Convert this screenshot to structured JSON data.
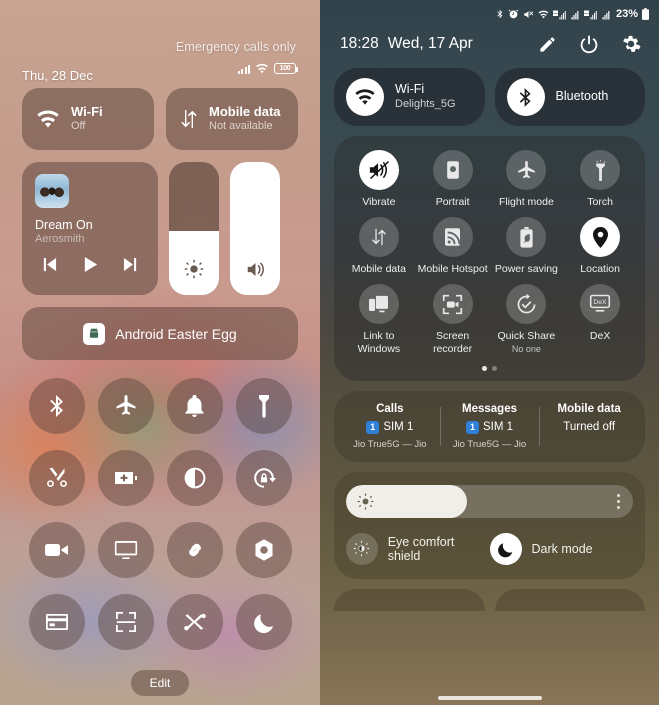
{
  "left": {
    "status": {
      "carrier_text": "Emergency calls only",
      "datetime": "Thu, 28 Dec",
      "battery_level": "100",
      "signal_icon": "signal-bars-icon",
      "wifi_icon": "wifi-icon",
      "battery_icon": "battery-icon"
    },
    "tiles": [
      {
        "name": "wifi",
        "title": "Wi-Fi",
        "sub": "Off",
        "icon": "wifi-icon"
      },
      {
        "name": "mobile-data",
        "title": "Mobile data",
        "sub": "Not available",
        "icon": "data-arrows-icon"
      }
    ],
    "media": {
      "track_title": "Dream On",
      "artist": "Aerosmith",
      "album_art_icon": "album-art",
      "prev_icon": "skip-previous-icon",
      "play_icon": "play-icon",
      "next_icon": "skip-next-icon"
    },
    "sliders": {
      "brightness": {
        "icon": "brightness-icon",
        "value": 48
      },
      "volume": {
        "icon": "volume-icon",
        "value": 100
      }
    },
    "easter_egg": {
      "label": "Android Easter Egg",
      "icon": "android-icon"
    },
    "toggles": [
      {
        "name": "bluetooth",
        "icon": "bluetooth-icon"
      },
      {
        "name": "airplane-mode",
        "icon": "airplane-icon"
      },
      {
        "name": "ring-mode",
        "icon": "bell-icon"
      },
      {
        "name": "flashlight",
        "icon": "flashlight-icon"
      },
      {
        "name": "screenshot",
        "icon": "scissors-icon"
      },
      {
        "name": "battery-saver",
        "icon": "battery-plus-icon"
      },
      {
        "name": "dark-theme",
        "icon": "contrast-circle-icon"
      },
      {
        "name": "auto-rotate",
        "icon": "rotation-lock-icon"
      },
      {
        "name": "screen-record",
        "icon": "video-camera-icon"
      },
      {
        "name": "cast",
        "icon": "screen-cast-icon"
      },
      {
        "name": "nearby-link",
        "icon": "chain-link-icon"
      },
      {
        "name": "camera-shortcut",
        "icon": "aperture-icon"
      },
      {
        "name": "wallet",
        "icon": "wallet-card-icon"
      },
      {
        "name": "qr-scanner",
        "icon": "qr-scan-icon"
      },
      {
        "name": "nearby-share",
        "icon": "nearby-share-icon"
      },
      {
        "name": "do-not-disturb",
        "icon": "moon-icon"
      }
    ],
    "edit_label": "Edit"
  },
  "right": {
    "statusbar": {
      "battery_percent": "23%",
      "icons": [
        "bluetooth-icon",
        "alarm-icon",
        "mute-icon",
        "wifi-icon",
        "volte-signal-icon",
        "signal-bars-icon",
        "volte-signal-icon",
        "signal-bars-icon"
      ]
    },
    "header": {
      "time": "18:28",
      "date": "Wed, 17 Apr",
      "edit_icon": "pencil-icon",
      "power_icon": "power-icon",
      "settings_icon": "gear-icon"
    },
    "connections": [
      {
        "name": "wifi",
        "title": "Wi-Fi",
        "sub": "Delights_5G",
        "icon": "wifi-icon",
        "active": true
      },
      {
        "name": "bluetooth",
        "title": "Bluetooth",
        "sub": "",
        "icon": "bluetooth-icon",
        "active": true
      }
    ],
    "quick_settings": [
      {
        "name": "vibrate",
        "label": "Vibrate",
        "sub": "",
        "icon": "vibrate-icon",
        "on": true
      },
      {
        "name": "portrait",
        "label": "Portrait",
        "sub": "",
        "icon": "rotation-lock-icon",
        "on": false
      },
      {
        "name": "flight-mode",
        "label": "Flight mode",
        "sub": "",
        "icon": "airplane-icon",
        "on": false
      },
      {
        "name": "torch",
        "label": "Torch",
        "sub": "",
        "icon": "flashlight-icon",
        "on": false
      },
      {
        "name": "mobile-data",
        "label": "Mobile data",
        "sub": "",
        "icon": "data-arrows-icon",
        "on": false
      },
      {
        "name": "mobile-hotspot",
        "label": "Mobile Hotspot",
        "sub": "",
        "icon": "hotspot-icon",
        "on": false
      },
      {
        "name": "power-saving",
        "label": "Power saving",
        "sub": "",
        "icon": "power-saving-icon",
        "on": false
      },
      {
        "name": "location",
        "label": "Location",
        "sub": "",
        "icon": "location-pin-icon",
        "on": true
      },
      {
        "name": "link-to-windows",
        "label": "Link to Windows",
        "sub": "",
        "icon": "link-to-windows-icon",
        "on": false
      },
      {
        "name": "screen-recorder",
        "label": "Screen recorder",
        "sub": "",
        "icon": "screen-record-icon",
        "on": false
      },
      {
        "name": "quick-share",
        "label": "Quick Share",
        "sub": "No one",
        "icon": "quick-share-icon",
        "on": false
      },
      {
        "name": "dex",
        "label": "DeX",
        "sub": "",
        "icon": "dex-icon",
        "on": false
      }
    ],
    "page_dots": {
      "count": 2,
      "active_index": 0
    },
    "sim_panel": [
      {
        "name": "calls",
        "head": "Calls",
        "badge": "1",
        "mid": "SIM 1",
        "foot": "Jio True5G — Jio"
      },
      {
        "name": "messages",
        "head": "Messages",
        "badge": "1",
        "mid": "SIM 1",
        "foot": "Jio True5G — Jio"
      },
      {
        "name": "mobile-data",
        "head": "Mobile data",
        "badge": "",
        "mid": "Turned off",
        "foot": ""
      }
    ],
    "brightness": {
      "value": 42,
      "icon": "brightness-icon",
      "menu_icon": "more-vertical-icon"
    },
    "modes": [
      {
        "name": "eye-comfort-shield",
        "label": "Eye comfort shield",
        "icon": "eye-comfort-icon",
        "on": false
      },
      {
        "name": "dark-mode",
        "label": "Dark mode",
        "icon": "moon-icon",
        "on": true
      }
    ]
  }
}
